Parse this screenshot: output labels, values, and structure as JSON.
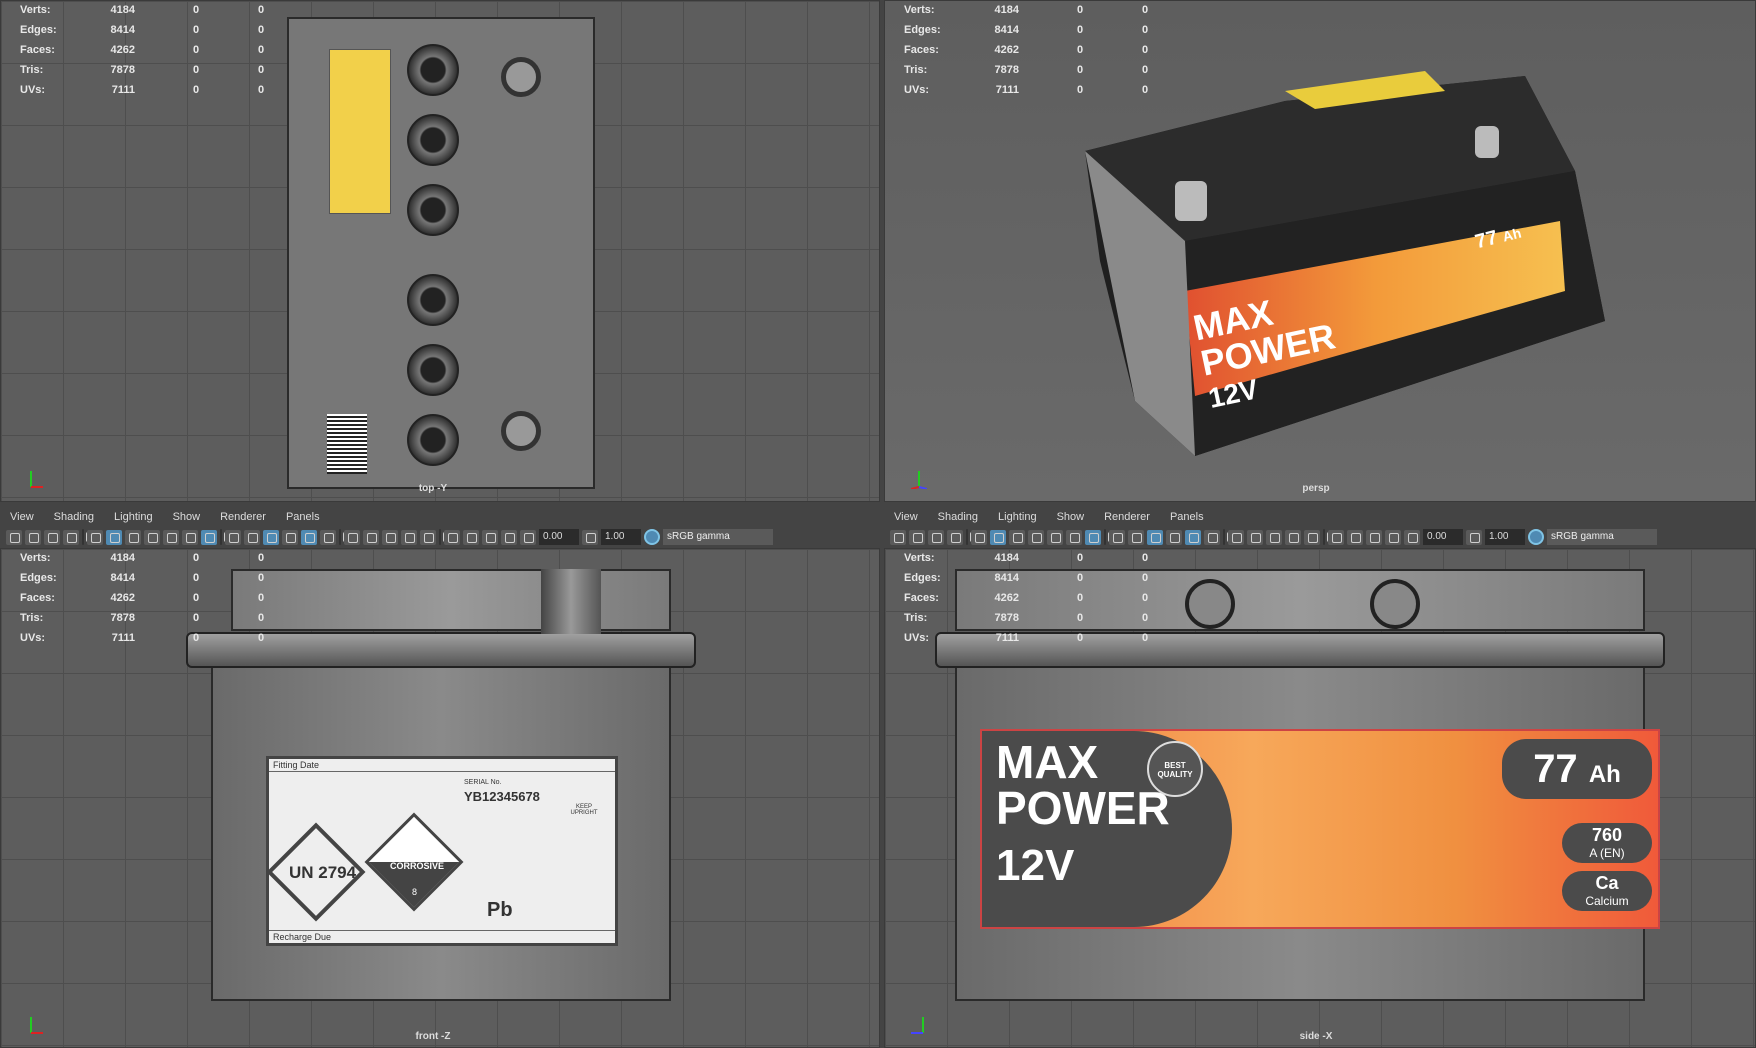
{
  "stats": [
    {
      "label": "Verts:",
      "value": "4184",
      "a": "0",
      "b": "0"
    },
    {
      "label": "Edges:",
      "value": "8414",
      "a": "0",
      "b": "0"
    },
    {
      "label": "Faces:",
      "value": "4262",
      "a": "0",
      "b": "0"
    },
    {
      "label": "Tris:",
      "value": "7878",
      "a": "0",
      "b": "0"
    },
    {
      "label": "UVs:",
      "value": "7111",
      "a": "0",
      "b": "0"
    }
  ],
  "viewports": {
    "top": "top -Y",
    "persp": "persp",
    "front": "front -Z",
    "side": "side -X"
  },
  "menu": [
    "View",
    "Shading",
    "Lighting",
    "Show",
    "Renderer",
    "Panels"
  ],
  "toolbar": {
    "exposure": "0.00",
    "gamma": "1.00",
    "colorspace": "sRGB gamma",
    "icons": [
      "select-camera-icon",
      "camera-attributes-icon",
      "bookmark-icon",
      "image-plane-icon",
      "grid-icon",
      "film-gate-icon",
      "resolution-gate-icon",
      "gate-mask-icon",
      "field-chart-icon",
      "safe-action-icon",
      "safe-title-icon",
      "wireframe-icon",
      "smooth-shade-icon",
      "default-material-icon",
      "wireframe-on-shaded-icon",
      "xray-icon",
      "use-all-lights-icon",
      "shadows-icon",
      "screen-space-ao-icon",
      "motion-blur-icon",
      "anti-aliasing-icon",
      "depth-of-field-icon",
      "isolate-select-icon",
      "xray-joints-icon",
      "xray-active-icon",
      "backface-culling-icon"
    ],
    "active": [
      5,
      10,
      13,
      15
    ]
  },
  "battery": {
    "brand_line1": "MAX",
    "brand_line2": "POWER",
    "badge": "BEST QUALITY",
    "voltage": "12V",
    "capacity": "77",
    "capacity_unit": "Ah",
    "cca": "760",
    "cca_unit": "A (EN)",
    "chem": "Ca",
    "chem_name": "Calcium",
    "un": "UN 2794",
    "corrosive": "CORROSIVE",
    "class": "8",
    "serial_label": "SERIAL No.",
    "serial": "YB12345678",
    "keep": "KEEP UPRIGHT",
    "pb": "Pb",
    "fitting": "Fitting Date",
    "recharge": "Recharge Due"
  }
}
